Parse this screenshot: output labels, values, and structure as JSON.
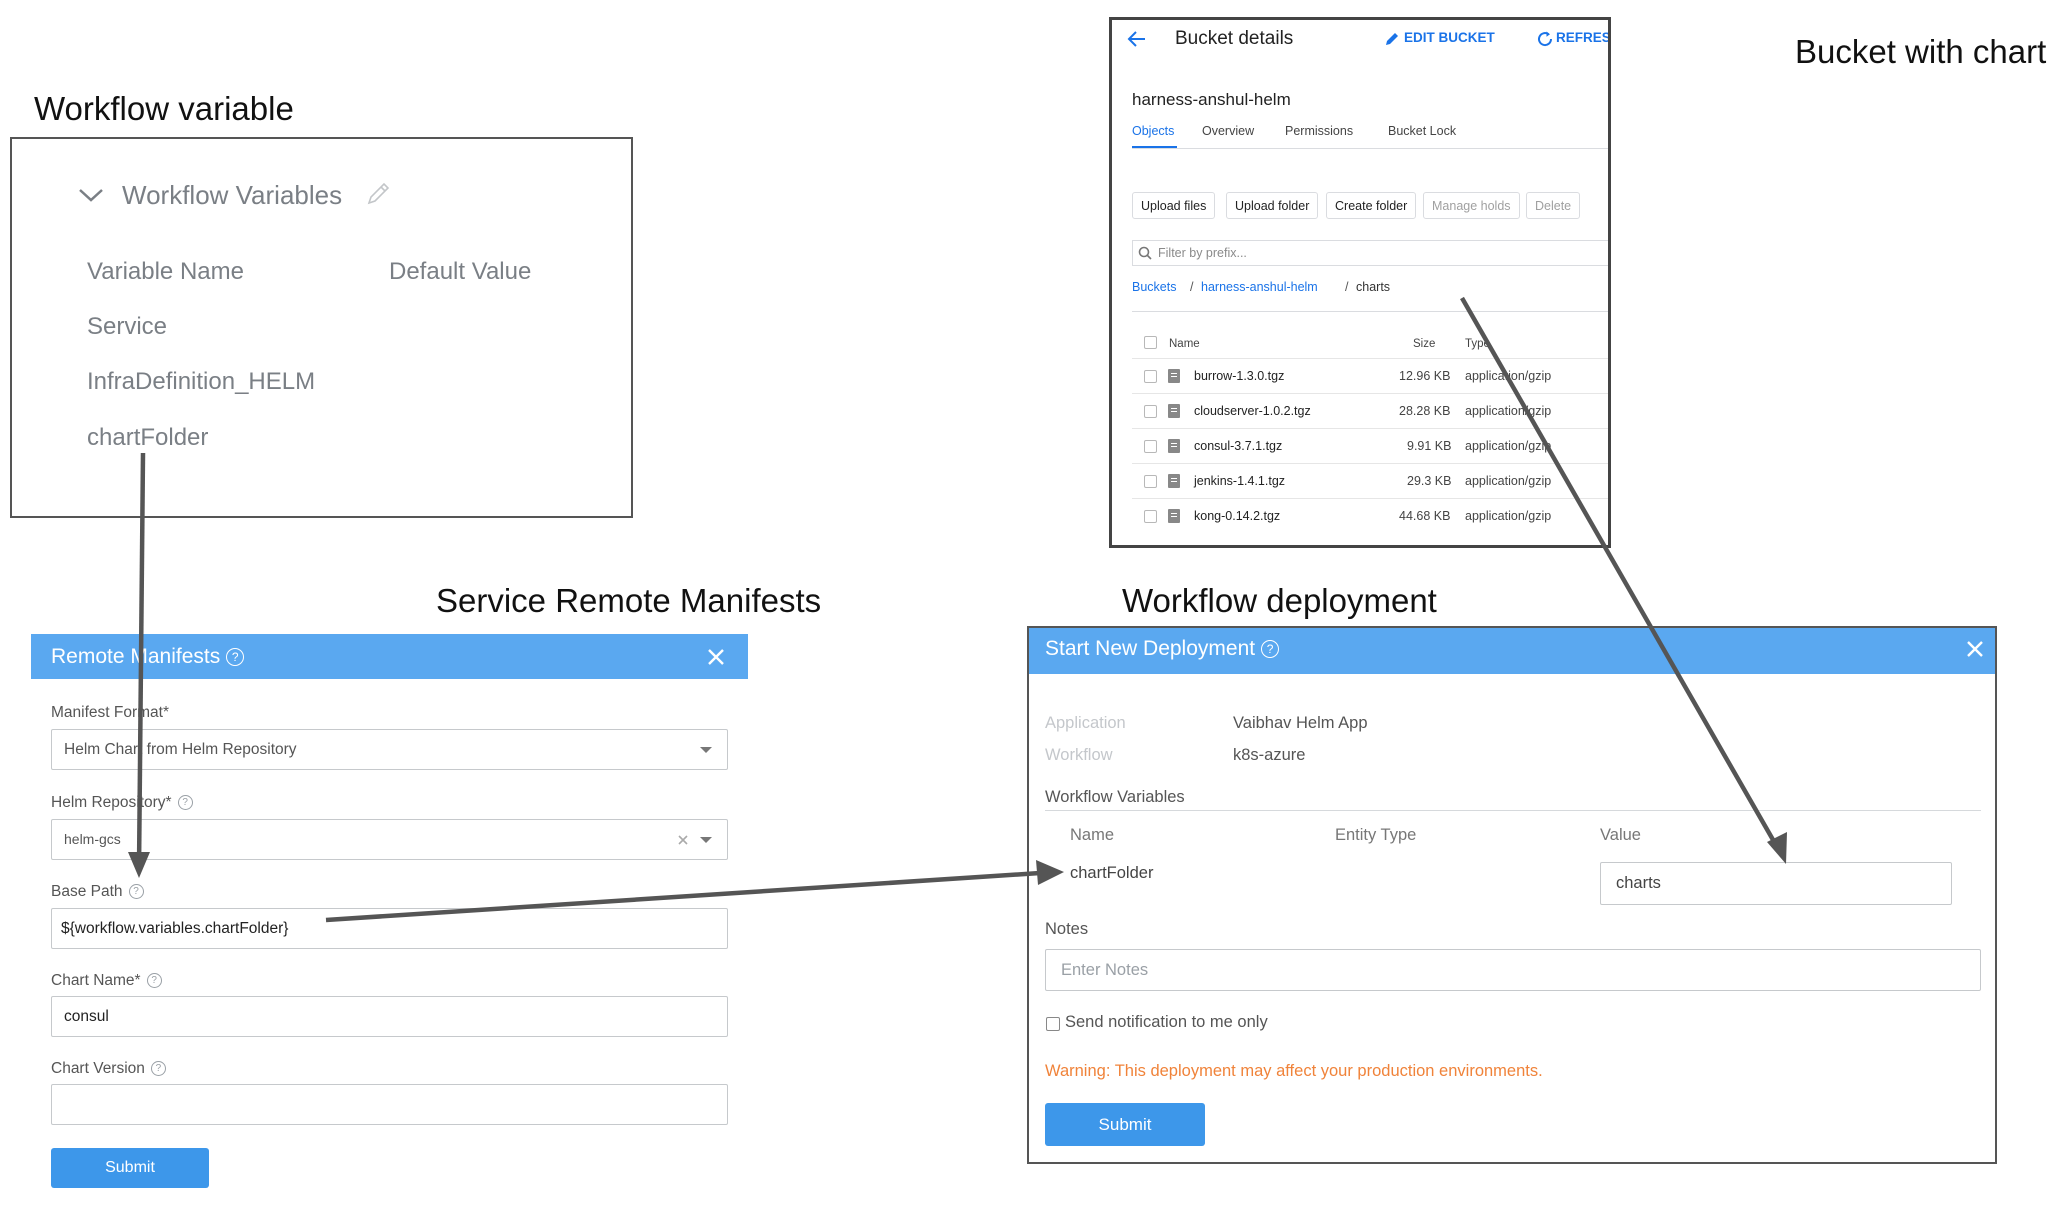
{
  "captions": {
    "workflow_variable": "Workflow variable",
    "bucket_with_chart": "Bucket with chart",
    "service_remote_manifests": "Service Remote Manifests",
    "workflow_deployment": "Workflow deployment"
  },
  "workflow_variables_panel": {
    "title": "Workflow Variables",
    "col_name": "Variable Name",
    "col_default": "Default Value",
    "variables": [
      "Service",
      "InfraDefinition_HELM",
      "chartFolder"
    ]
  },
  "bucket": {
    "title": "Bucket details",
    "edit_label": "EDIT BUCKET",
    "refresh_label": "REFRES",
    "name": "harness-anshul-helm",
    "tabs": [
      "Objects",
      "Overview",
      "Permissions",
      "Bucket Lock"
    ],
    "buttons": [
      "Upload files",
      "Upload folder",
      "Create folder",
      "Manage holds",
      "Delete"
    ],
    "filter_placeholder": "Filter by prefix...",
    "breadcrumb": [
      "Buckets",
      "harness-anshul-helm",
      "charts"
    ],
    "columns": {
      "name": "Name",
      "size": "Size",
      "type": "Type"
    },
    "files": [
      {
        "name": "burrow-1.3.0.tgz",
        "size": "12.96 KB",
        "type": "application/gzip"
      },
      {
        "name": "cloudserver-1.0.2.tgz",
        "size": "28.28 KB",
        "type": "application/gzip"
      },
      {
        "name": "consul-3.7.1.tgz",
        "size": "9.91 KB",
        "type": "application/gzip"
      },
      {
        "name": "jenkins-1.4.1.tgz",
        "size": "29.3 KB",
        "type": "application/gzip"
      },
      {
        "name": "kong-0.14.2.tgz",
        "size": "44.68 KB",
        "type": "application/gzip"
      }
    ]
  },
  "remote_manifests": {
    "title": "Remote Manifests",
    "manifest_format_label": "Manifest Format*",
    "manifest_format_value": "Helm Chart from Helm Repository",
    "helm_repository_label": "Helm Repository*",
    "helm_repository_value": "helm-gcs",
    "base_path_label": "Base Path",
    "base_path_value": "${workflow.variables.chartFolder}",
    "chart_name_label": "Chart Name*",
    "chart_name_value": "consul",
    "chart_version_label": "Chart Version",
    "chart_version_value": "",
    "submit_label": "Submit",
    "accent": "#5aa8f0"
  },
  "deployment": {
    "title": "Start New Deployment",
    "application_label": "Application",
    "application_value": "Vaibhav Helm App",
    "workflow_label": "Workflow",
    "workflow_value": "k8s-azure",
    "section_title": "Workflow Variables",
    "col_name": "Name",
    "col_entity": "Entity Type",
    "col_value": "Value",
    "variable_name": "chartFolder",
    "variable_value": "charts",
    "notes_label": "Notes",
    "notes_placeholder": "Enter Notes",
    "notify_label": "Send notification to me only",
    "warning": "Warning: This deployment may affect your production environments.",
    "submit_label": "Submit",
    "warning_color": "#f0833a",
    "accent": "#3d97ea"
  }
}
